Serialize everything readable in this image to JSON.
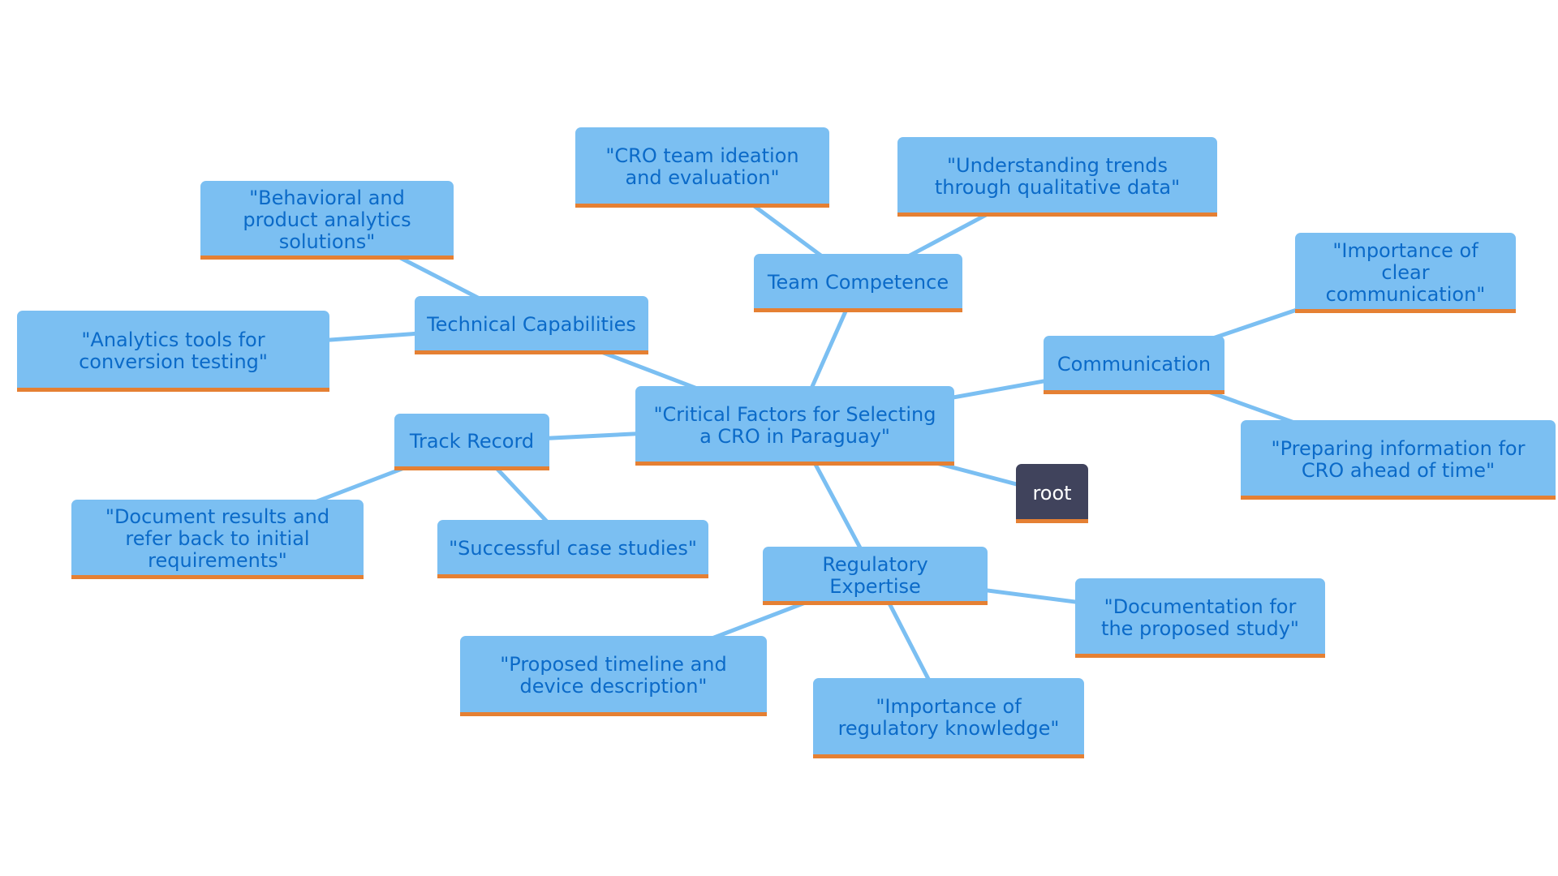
{
  "colors": {
    "node_fill": "#7bbff2",
    "node_text": "#0b6ac8",
    "accent_underline": "#e58033",
    "root_fill": "#40435c",
    "root_text": "#ffffff",
    "edge": "#7bbff2"
  },
  "nodes": [
    {
      "id": "central",
      "label": "\"Critical Factors for Selecting a CRO in Paraguay\""
    },
    {
      "id": "team",
      "label": "Team Competence"
    },
    {
      "id": "cro-team",
      "label": "\"CRO team ideation and evaluation\""
    },
    {
      "id": "trends",
      "label": "\"Understanding trends through qualitative data\""
    },
    {
      "id": "technical",
      "label": "Technical Capabilities"
    },
    {
      "id": "behavioral",
      "label": "\"Behavioral and product analytics solutions\""
    },
    {
      "id": "analytics",
      "label": "\"Analytics tools for conversion testing\""
    },
    {
      "id": "track",
      "label": "Track Record"
    },
    {
      "id": "document",
      "label": "\"Document results and refer back to initial requirements\""
    },
    {
      "id": "case",
      "label": "\"Successful case studies\""
    },
    {
      "id": "regulatory",
      "label": "Regulatory Expertise"
    },
    {
      "id": "timeline",
      "label": "\"Proposed timeline and device description\""
    },
    {
      "id": "reg-knowledge",
      "label": "\"Importance of regulatory knowledge\""
    },
    {
      "id": "documentation",
      "label": "\"Documentation for the proposed study\""
    },
    {
      "id": "communication",
      "label": "Communication"
    },
    {
      "id": "clear-comm",
      "label": "\"Importance of clear communication\""
    },
    {
      "id": "preparing",
      "label": "\"Preparing information for CRO ahead of time\""
    },
    {
      "id": "root",
      "label": "root"
    }
  ],
  "edges": [
    [
      "central",
      "team"
    ],
    [
      "team",
      "cro-team"
    ],
    [
      "team",
      "trends"
    ],
    [
      "central",
      "technical"
    ],
    [
      "technical",
      "behavioral"
    ],
    [
      "technical",
      "analytics"
    ],
    [
      "central",
      "track"
    ],
    [
      "track",
      "document"
    ],
    [
      "track",
      "case"
    ],
    [
      "central",
      "regulatory"
    ],
    [
      "regulatory",
      "timeline"
    ],
    [
      "regulatory",
      "reg-knowledge"
    ],
    [
      "regulatory",
      "documentation"
    ],
    [
      "central",
      "communication"
    ],
    [
      "communication",
      "clear-comm"
    ],
    [
      "communication",
      "preparing"
    ],
    [
      "central",
      "root"
    ]
  ]
}
